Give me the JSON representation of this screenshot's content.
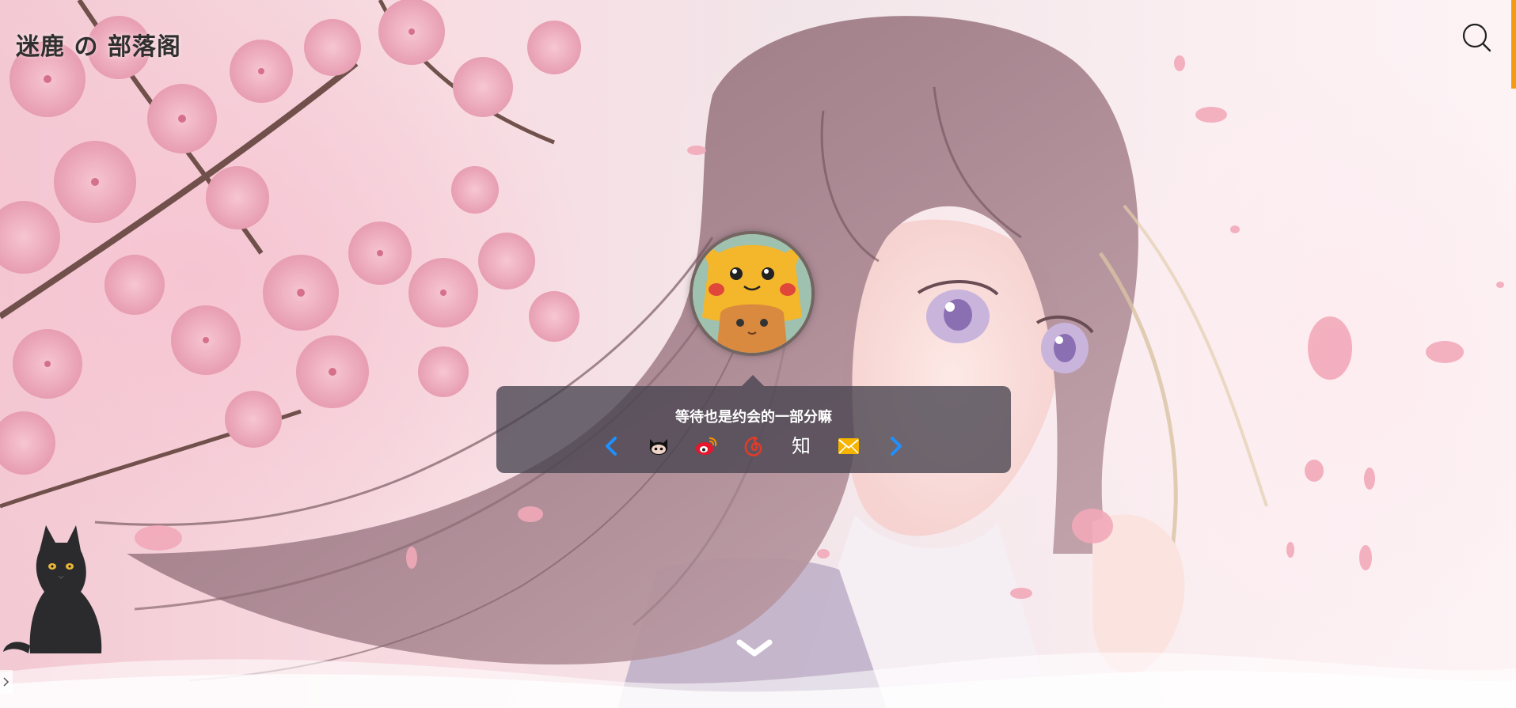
{
  "header": {
    "site_title": "迷鹿 の 部落阁",
    "search_icon": "search-icon"
  },
  "hero": {
    "motto": "等待也是约会的一部分嘛",
    "avatar_alt": "avatar",
    "social": {
      "prev_icon": "chevron-left-icon",
      "next_icon": "chevron-right-icon",
      "items": [
        {
          "icon": "github-icon"
        },
        {
          "icon": "weibo-icon"
        },
        {
          "icon": "netease-music-icon"
        },
        {
          "icon": "zhihu-icon",
          "label": "知"
        },
        {
          "icon": "email-icon"
        }
      ]
    },
    "scroll_down_icon": "chevron-down-icon"
  },
  "colors": {
    "accent": "#f39c12",
    "chevron_blue": "#1e90ff",
    "weibo_red": "#e6162d",
    "netease_red": "#e03b2a",
    "mail_yellow": "#f5b400"
  }
}
